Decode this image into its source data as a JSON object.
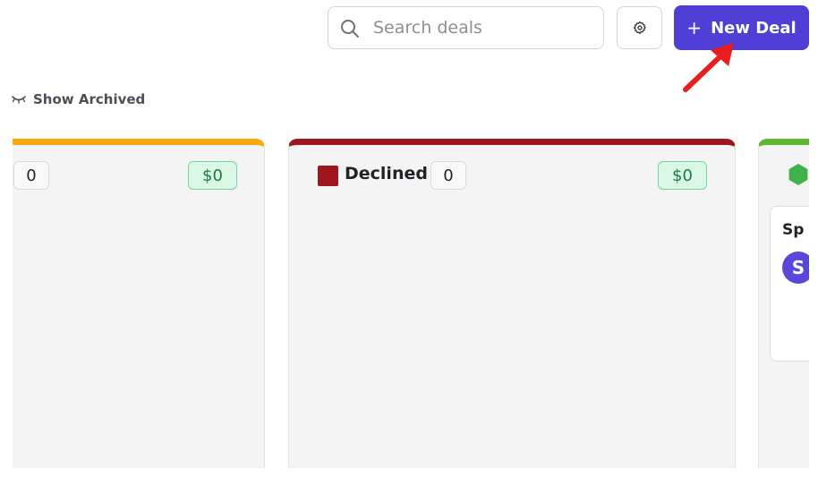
{
  "toolbar": {
    "search": {
      "placeholder": "Search deals",
      "icon": "search-icon"
    },
    "settings": {
      "icon": "gear-icon"
    },
    "new_deal": {
      "plus": "+",
      "label": "New Deal",
      "color": "#4f3fd6"
    },
    "show_archived": {
      "icon": "eye-closed-icon",
      "label": "Show Archived"
    }
  },
  "annotation": {
    "arrow_color": "#e81e1e"
  },
  "board": {
    "columns": [
      {
        "title": "",
        "count": "0",
        "amount": "$0",
        "accent": "#f8a80c"
      },
      {
        "title": "Declined",
        "count": "0",
        "amount": "$0",
        "accent": "#a0161e"
      },
      {
        "title": "",
        "accent": "#5bb830",
        "icon": "hexagon-icon",
        "cards": [
          {
            "name": "Sp",
            "avatar_initial": "S",
            "avatar_color": "#5a46d8"
          }
        ]
      }
    ]
  }
}
